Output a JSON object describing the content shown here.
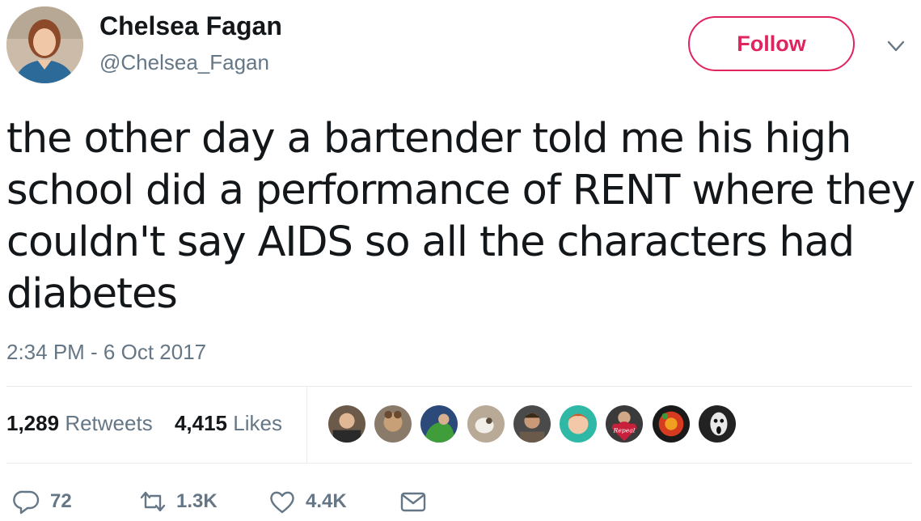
{
  "user": {
    "display_name": "Chelsea Fagan",
    "handle": "@Chelsea_Fagan"
  },
  "follow_label": "Follow",
  "tweet": {
    "text": "the other day a bartender told me his high\nschool did a performance of RENT where they\ncouldn't say AIDS so all the characters had\ndiabetes",
    "timestamp": "2:34 PM - 6 Oct 2017"
  },
  "stats": {
    "retweets_count": "1,289",
    "retweets_label": "Retweets",
    "likes_count": "4,415",
    "likes_label": "Likes"
  },
  "liker_avatars": [
    {
      "name": "liker-avatar-1",
      "color": "#6b5a4a"
    },
    {
      "name": "liker-avatar-2",
      "color": "#8a7a6a"
    },
    {
      "name": "liker-avatar-3",
      "color": "#3f7d3a"
    },
    {
      "name": "liker-avatar-4",
      "color": "#b9aa98"
    },
    {
      "name": "liker-avatar-5",
      "color": "#4a4a4a"
    },
    {
      "name": "liker-avatar-6",
      "color": "#2fb8a6"
    },
    {
      "name": "liker-avatar-7",
      "color": "#c8203a"
    },
    {
      "name": "liker-avatar-8",
      "color": "#d63a1f"
    },
    {
      "name": "liker-avatar-9",
      "color": "#222222"
    }
  ],
  "avatar_badge_text": "Repeal",
  "actions": {
    "reply_count": "72",
    "retweet_count": "1.3K",
    "like_count": "4.4K"
  },
  "colors": {
    "follow_accent": "#e0245e",
    "secondary_text": "#657786",
    "primary_text": "#14171a",
    "divider": "#e6ecf0"
  },
  "icons": {
    "reply": "reply-icon",
    "retweet": "retweet-icon",
    "like": "heart-icon",
    "message": "envelope-icon",
    "menu": "chevron-down-icon"
  }
}
